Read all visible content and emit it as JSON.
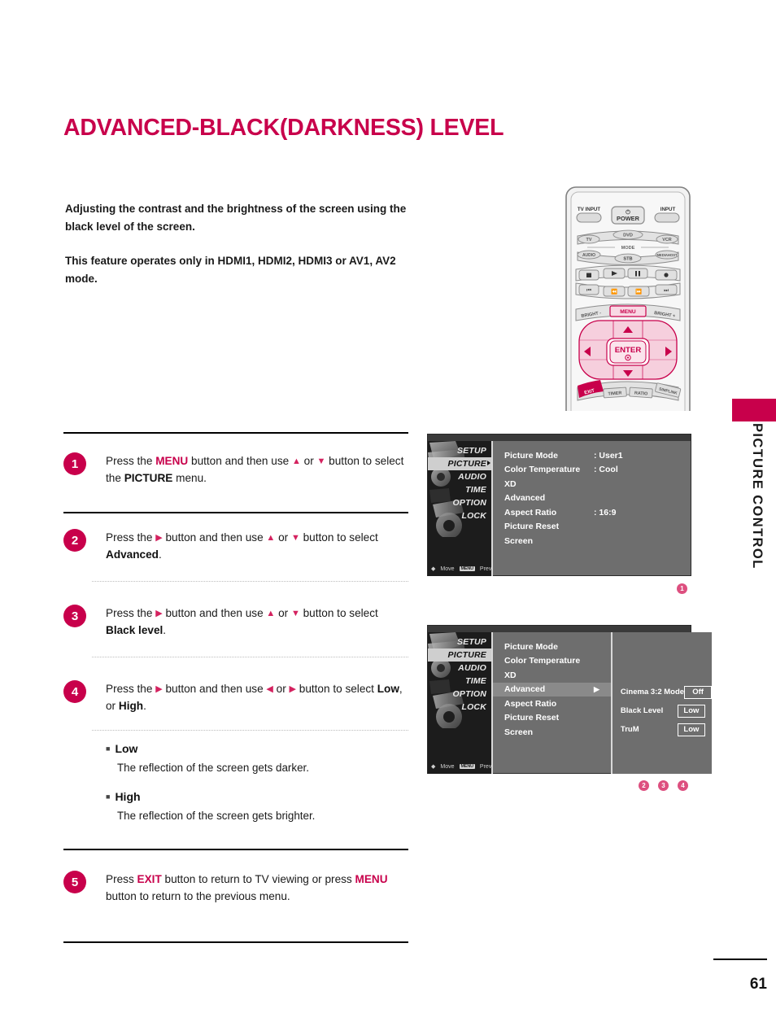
{
  "page": {
    "title": "ADVANCED-BLACK(DARKNESS) LEVEL",
    "number": "61",
    "side_label": "PICTURE CONTROL",
    "accent_color": "#c8004b"
  },
  "intro": {
    "paragraph1": "Adjusting the contrast and the brightness of the screen using the black level of the screen.",
    "paragraph2": "This feature operates only in HDMI1, HDMI2, HDMI3 or AV1, AV2 mode."
  },
  "steps": [
    {
      "number": "1",
      "pre": "Press the ",
      "kw1": "MENU",
      "mid1": " button and then use ",
      "mid2": " or ",
      "mid3": " button to select the ",
      "kw2": "PICTURE",
      "post": " menu."
    },
    {
      "number": "2",
      "pre": "Press the ",
      "mid1": " button and then use ",
      "mid2": " or ",
      "mid3": " button to select ",
      "target": "Advanced",
      "post": "."
    },
    {
      "number": "3",
      "pre": "Press the ",
      "mid1": " button and then use ",
      "mid2": " or ",
      "mid3": " button to select ",
      "target": "Black level",
      "post": "."
    },
    {
      "number": "4",
      "pre": "Press the ",
      "mid1": " button and then use ",
      "mid2": " or ",
      "mid3": " button to select ",
      "target1": "Low",
      "sep": ", or ",
      "target2": "High",
      "post": "."
    },
    {
      "number": "5",
      "pre": "Press ",
      "kw1": "EXIT",
      "mid1": " button to return to TV viewing or press ",
      "kw2": "MENU",
      "post": " button to return to the previous menu."
    }
  ],
  "explanations": [
    {
      "heading": "Low",
      "body": "The reflection of the screen gets darker."
    },
    {
      "heading": "High",
      "body": "The reflection of the screen gets brighter."
    }
  ],
  "osd1": {
    "categories": [
      "SETUP",
      "PICTURE",
      "AUDIO",
      "TIME",
      "OPTION",
      "LOCK"
    ],
    "active_category": "PICTURE",
    "footer_move": "Move",
    "footer_menu_key": "MENU",
    "footer_prev": "Prev",
    "rows": [
      {
        "label": "Picture Mode",
        "value": ": User1"
      },
      {
        "label": "Color Temperature",
        "value": ": Cool"
      },
      {
        "label": "XD",
        "value": ""
      },
      {
        "label": "Advanced",
        "value": ""
      },
      {
        "label": "Aspect Ratio",
        "value": ": 16:9"
      },
      {
        "label": "Picture Reset",
        "value": ""
      },
      {
        "label": "Screen",
        "value": ""
      }
    ],
    "marker": "1"
  },
  "osd2": {
    "categories": [
      "SETUP",
      "PICTURE",
      "AUDIO",
      "TIME",
      "OPTION",
      "LOCK"
    ],
    "active_category": "PICTURE",
    "footer_move": "Move",
    "footer_menu_key": "MENU",
    "footer_prev": "Prev",
    "rows": [
      {
        "label": "Picture Mode",
        "selected": false
      },
      {
        "label": "Color Temperature",
        "selected": false
      },
      {
        "label": "XD",
        "selected": false
      },
      {
        "label": "Advanced",
        "selected": true
      },
      {
        "label": "Aspect Ratio",
        "selected": false
      },
      {
        "label": "Picture Reset",
        "selected": false
      },
      {
        "label": "Screen",
        "selected": false
      }
    ],
    "submenu": [
      {
        "label": "Cinema 3:2 Mode",
        "value": "Off"
      },
      {
        "label": "Black Level",
        "value": "Low"
      },
      {
        "label": "TruM",
        "value": "Low"
      }
    ],
    "markers": [
      "2",
      "3",
      "4"
    ]
  },
  "remote": {
    "tv_input": "TV INPUT",
    "power": "POWER",
    "input": "INPUT",
    "mode_label": "MODE",
    "mode_row1": [
      "TV",
      "DVD",
      "VCR"
    ],
    "mode_row2": [
      "AUDIO",
      "STB",
      "MEDIA HOST"
    ],
    "bright_minus": "BRIGHT -",
    "menu": "MENU",
    "bright_plus": "BRIGHT +",
    "enter": "ENTER",
    "exit": "EXIT",
    "bottom_keys": [
      "TIMER",
      "RATIO",
      "SIMPLINK"
    ]
  }
}
